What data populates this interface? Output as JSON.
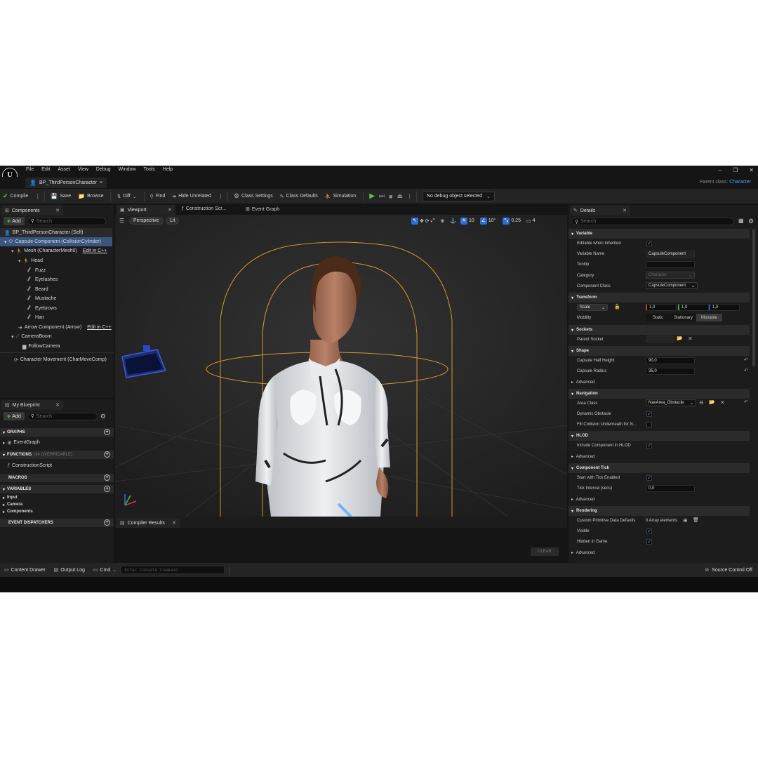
{
  "menu": {
    "items": [
      "File",
      "Edit",
      "Asset",
      "View",
      "Debug",
      "Window",
      "Tools",
      "Help"
    ]
  },
  "window": {
    "minimize": "–",
    "restore": "❐",
    "close": "✕"
  },
  "doc_tab": {
    "label": "BP_ThirdPersonCharacter",
    "close": "×"
  },
  "parent_class": {
    "label": "Parent class:",
    "value": "Character"
  },
  "toolbar": {
    "compile": "Compile",
    "save": "Save",
    "browse": "Browse",
    "diff": "Diff",
    "find": "Find",
    "hide_unrelated": "Hide Unrelated",
    "class_settings": "Class Settings",
    "class_defaults": "Class Defaults",
    "simulation": "Simulation",
    "debug_object": "No debug object selected"
  },
  "components_panel": {
    "tab": "Components",
    "add": "Add",
    "search_placeholder": "Search",
    "items": [
      {
        "label": "BP_ThirdPersonCharacter (Self)"
      },
      {
        "label": "Capsule Component (CollisionCylinder)"
      },
      {
        "label": "Mesh (CharacterMesh0)",
        "edit": "Edit in C++"
      },
      {
        "label": "Head"
      },
      {
        "label": "Fuzz"
      },
      {
        "label": "Eyelashes"
      },
      {
        "label": "Beard"
      },
      {
        "label": "Mustache"
      },
      {
        "label": "Eyebrows"
      },
      {
        "label": "Hair"
      },
      {
        "label": "Arrow Component (Arrow)",
        "edit": "Edit in C++"
      },
      {
        "label": "CameraBoom"
      },
      {
        "label": "FollowCamera"
      },
      {
        "label": "Character Movement (CharMoveComp)"
      }
    ]
  },
  "blueprint_panel": {
    "tab": "My Blueprint",
    "add": "Add",
    "search_placeholder": "Search",
    "graphs": "GRAPHS",
    "event_graph": "EventGraph",
    "functions": "FUNCTIONS",
    "functions_count": "(34 OVERRIDABLE)",
    "construction_script": "ConstructionScript",
    "macros": "MACROS",
    "variables": "VARIABLES",
    "var_items": [
      "Input",
      "Camera",
      "Components"
    ],
    "event_dispatchers": "EVENT DISPATCHERS"
  },
  "editor_tabs": {
    "viewport": "Viewport",
    "construction": "Construction Scr...",
    "event_graph": "Event Graph"
  },
  "viewport": {
    "perspective": "Perspective",
    "lit": "Lit",
    "grid": "10",
    "angle": "10°",
    "scale": "0.25",
    "camera_speed": "4"
  },
  "details": {
    "tab": "Details",
    "search_placeholder": "Search",
    "variable": "Variable",
    "editable_when_inherited": "Editable when Inherited",
    "variable_name_label": "Variable Name",
    "variable_name": "CapsuleComponent",
    "tooltip_label": "Tooltip",
    "category_label": "Category",
    "category": "Character",
    "component_class_label": "Component Class",
    "component_class": "CapsuleComponent",
    "transform": "Transform",
    "scale_label": "Scale",
    "scale_x": "1,0",
    "scale_y": "1,0",
    "scale_z": "1,0",
    "mobility_label": "Mobility",
    "mobility_static": "Static",
    "mobility_stationary": "Stationary",
    "mobility_movable": "Movable",
    "sockets": "Sockets",
    "parent_socket": "Parent Socket",
    "shape": "Shape",
    "half_height_label": "Capsule Half Height",
    "half_height": "90,0",
    "radius_label": "Capsule Radius",
    "radius": "35,0",
    "advanced": "Advanced",
    "navigation": "Navigation",
    "area_class_label": "Area Class",
    "area_class": "NavArea_Obstacle",
    "dynamic_obstacle": "Dynamic Obstacle",
    "fill_collision": "Fill Collision Underneath for N...",
    "hlod": "HLOD",
    "include_hlod": "Include Component in HLOD",
    "component_tick": "Component Tick",
    "start_tick": "Start with Tick Enabled",
    "tick_interval_label": "Tick Interval (secs)",
    "tick_interval": "0,0",
    "rendering": "Rendering",
    "custom_primitive": "Custom Primitive Data Defaults",
    "array_elements": "0 Array elements",
    "visible": "Visible",
    "hidden_in_game": "Hidden in Game"
  },
  "compiler": {
    "tab": "Compiler Results",
    "clear": "CLEAR"
  },
  "statusbar": {
    "content_drawer": "Content Drawer",
    "output_log": "Output Log",
    "cmd": "Cmd",
    "console_placeholder": "Enter Console Command",
    "source_control": "Source Control Off"
  }
}
